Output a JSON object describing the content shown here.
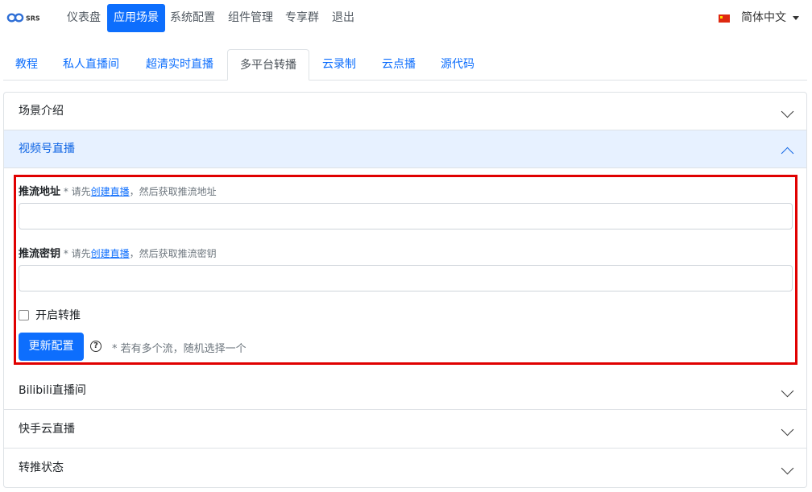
{
  "logo": {
    "text": "SRS"
  },
  "nav": {
    "items": [
      "仪表盘",
      "应用场景",
      "系统配置",
      "组件管理",
      "专享群",
      "退出"
    ],
    "active_index": 1,
    "language": "简体中文"
  },
  "tabs": {
    "items": [
      "教程",
      "私人直播间",
      "超清实时直播",
      "多平台转播",
      "云录制",
      "云点播",
      "源代码"
    ],
    "active_index": 3
  },
  "accordion": {
    "sections": [
      "场景介绍",
      "视频号直播",
      "Bilibili直播间",
      "快手云直播",
      "转推状态"
    ],
    "open_index": 1
  },
  "form": {
    "push_url_label": "推流地址",
    "push_url_hint_prefix": " * 请先",
    "push_url_link": "创建直播",
    "push_url_hint_suffix": "，然后获取推流地址",
    "push_url_value": "",
    "push_key_label": "推流密钥",
    "push_key_hint_prefix": " * 请先",
    "push_key_link": "创建直播",
    "push_key_hint_suffix": "，然后获取推流密钥",
    "push_key_value": "",
    "enable_label": "开启转推",
    "enable_checked": false,
    "update_button": "更新配置",
    "help_icon_glyph": "?",
    "tip": "* 若有多个流，随机选择一个"
  },
  "colors": {
    "primary": "#0d6efd",
    "highlight_border": "#e00000",
    "open_header_bg": "#e7f1ff"
  }
}
